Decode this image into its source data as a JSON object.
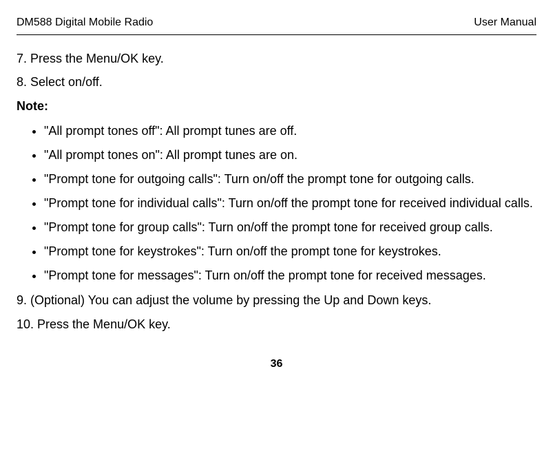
{
  "header": {
    "left": "DM588 Digital Mobile Radio",
    "right": "User Manual"
  },
  "steps": {
    "s7": "7. Press the Menu/OK key.",
    "s8": "8. Select on/off.",
    "s9": "9. (Optional) You can adjust the volume by pressing the Up and Down keys.",
    "s10": "10. Press the Menu/OK key."
  },
  "noteLabel": "Note:",
  "notes": [
    "\"All prompt tones off\": All prompt tunes are off.",
    "\"All prompt tones on\": All prompt tunes are on.",
    "\"Prompt tone for outgoing calls\": Turn on/off the prompt tone for outgoing calls.",
    "\"Prompt tone for individual calls\": Turn on/off the prompt tone for received individual calls.",
    "\"Prompt tone for group calls\": Turn on/off the prompt tone for received group calls.",
    "\"Prompt tone for keystrokes\": Turn on/off the prompt tone for keystrokes.",
    "\"Prompt tone for messages\": Turn on/off the prompt tone for received messages."
  ],
  "pageNumber": "36"
}
